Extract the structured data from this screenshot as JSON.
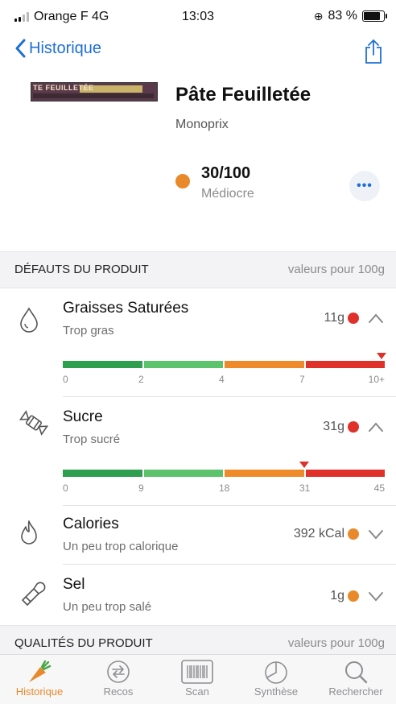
{
  "status": {
    "carrier": "Orange F 4G",
    "time": "13:03",
    "battery": "83 %",
    "battery_level": 0.83
  },
  "nav": {
    "back_label": "Historique"
  },
  "product": {
    "thumb_text": "TE FEUILLETÉE",
    "name": "Pâte Feuilletée",
    "brand": "Monoprix",
    "score": "30/100",
    "score_label": "Médiocre",
    "score_color": "#e8892b",
    "more_label": "•••"
  },
  "defects": {
    "title": "DÉFAUTS DU PRODUIT",
    "per": "valeurs pour 100g",
    "items": [
      {
        "title": "Graisses Saturées",
        "sub": "Trop gras",
        "value": "11g",
        "dot": "#e0302a",
        "icon": "drop-icon",
        "chevron": "up",
        "scale": {
          "ticks": [
            "0",
            "2",
            "4",
            "7",
            "10+"
          ],
          "colors": [
            "#2e9e4f",
            "#5cc26b",
            "#ef8a2b",
            "#e0302a"
          ],
          "marker": 0.99
        }
      },
      {
        "title": "Sucre",
        "sub": "Trop sucré",
        "value": "31g",
        "dot": "#e0302a",
        "icon": "candy-icon",
        "chevron": "up",
        "scale": {
          "ticks": [
            "0",
            "9",
            "18",
            "31",
            "45"
          ],
          "colors": [
            "#2e9e4f",
            "#5cc26b",
            "#ef8a2b",
            "#e0302a"
          ],
          "marker": 0.75
        }
      },
      {
        "title": "Calories",
        "sub": "Un peu trop calorique",
        "value": "392 kCal",
        "dot": "#e8892b",
        "icon": "flame-icon",
        "chevron": "down"
      },
      {
        "title": "Sel",
        "sub": "Un peu trop salé",
        "value": "1g",
        "dot": "#e8892b",
        "icon": "salt-shaker-icon",
        "chevron": "down"
      }
    ]
  },
  "qualities": {
    "title": "QUALITÉS DU PRODUIT",
    "per": "valeurs pour 100g"
  },
  "tabs": [
    {
      "label": "Historique",
      "icon": "carrot-icon",
      "active": true
    },
    {
      "label": "Recos",
      "icon": "recommendations-icon",
      "active": false
    },
    {
      "label": "Scan",
      "icon": "barcode-icon",
      "active": false
    },
    {
      "label": "Synthèse",
      "icon": "pie-chart-icon",
      "active": false
    },
    {
      "label": "Rechercher",
      "icon": "search-icon",
      "active": false
    }
  ]
}
